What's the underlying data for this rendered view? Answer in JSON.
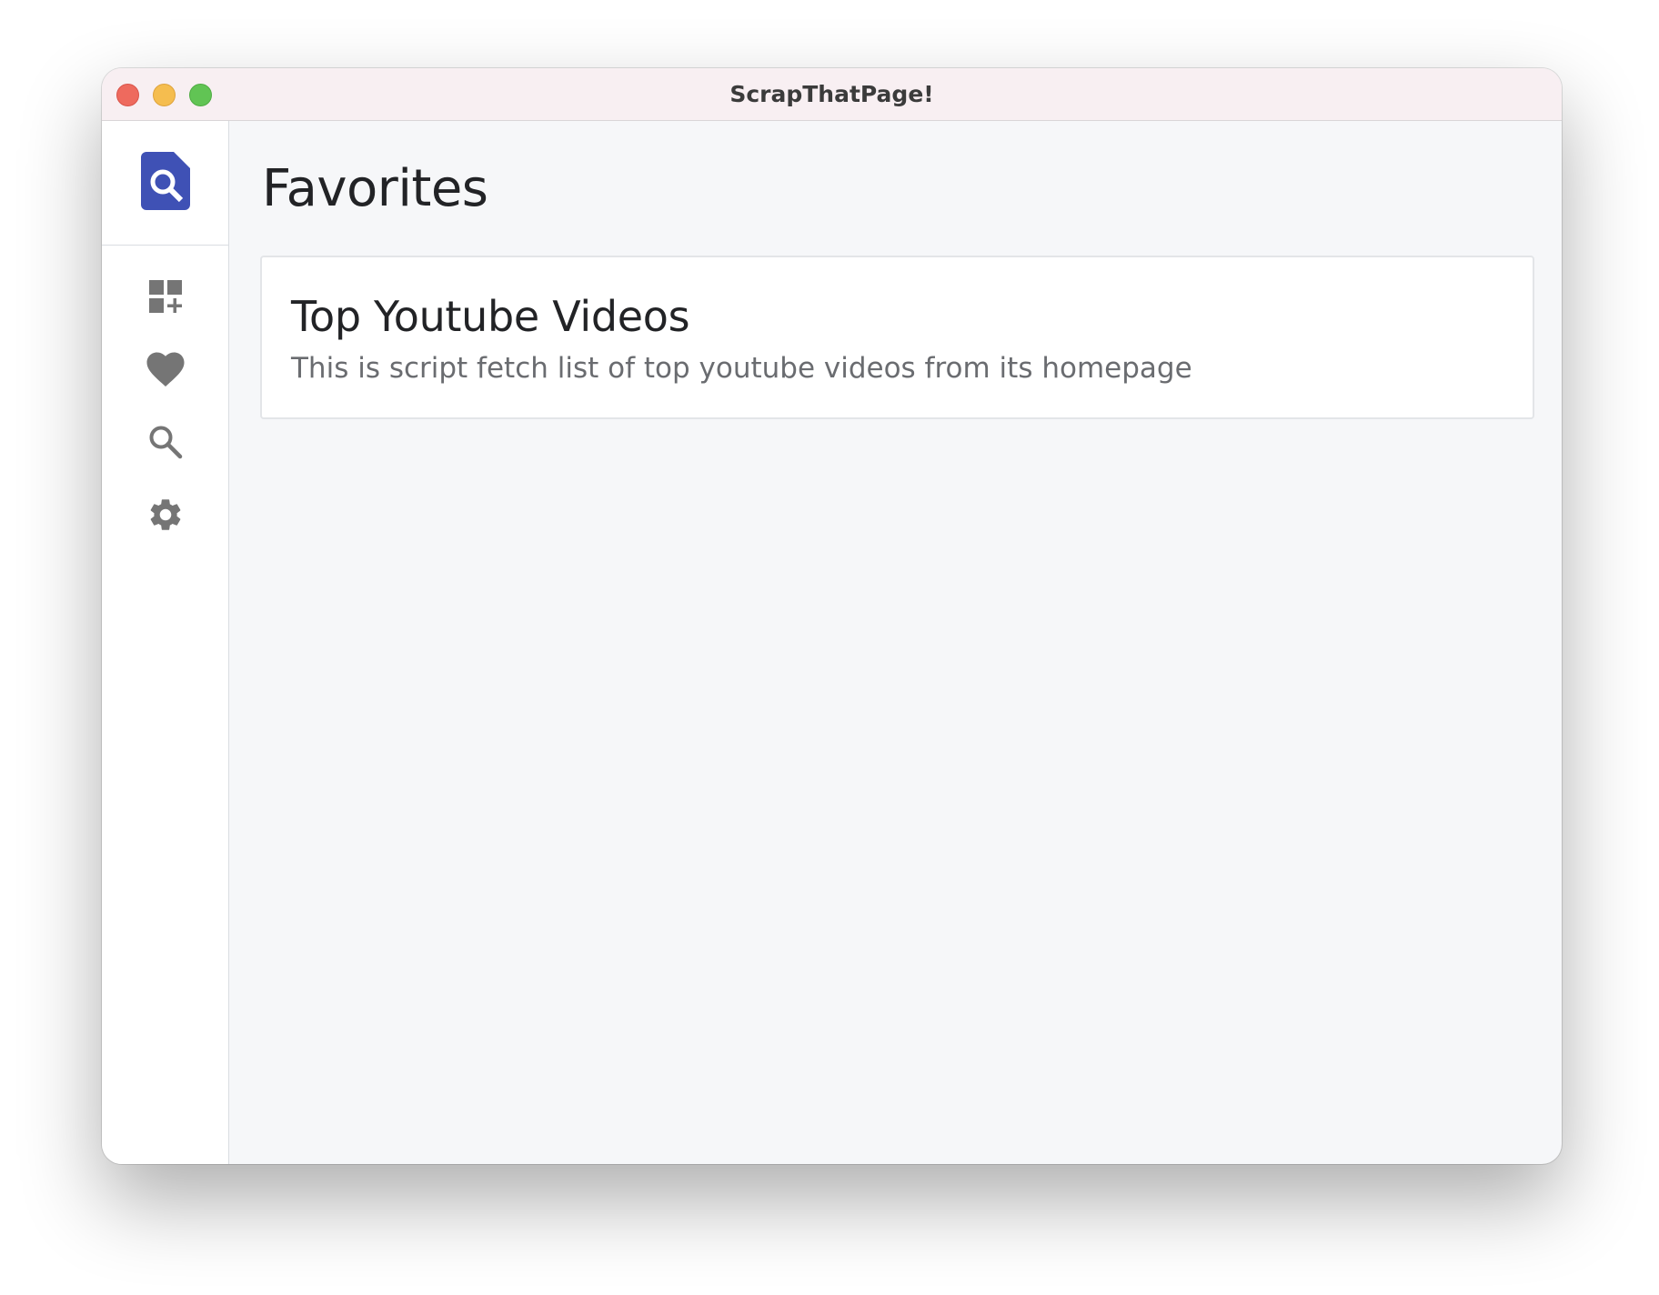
{
  "window": {
    "title": "ScrapThatPage!"
  },
  "sidebar": {
    "logo_icon": "document-search-icon",
    "items": [
      {
        "icon": "dashboard-add-icon",
        "label": ""
      },
      {
        "icon": "heart-icon",
        "label": ""
      },
      {
        "icon": "search-icon",
        "label": ""
      },
      {
        "icon": "gear-icon",
        "label": ""
      }
    ]
  },
  "main": {
    "title": "Favorites",
    "cards": [
      {
        "title": "Top Youtube Videos",
        "description": "This is script fetch list of top youtube videos from its homepage"
      }
    ]
  },
  "colors": {
    "brand": "#3f51b5",
    "icon": "#757575",
    "titlebar": "#f8eff2",
    "content_bg": "#f6f7f9"
  }
}
